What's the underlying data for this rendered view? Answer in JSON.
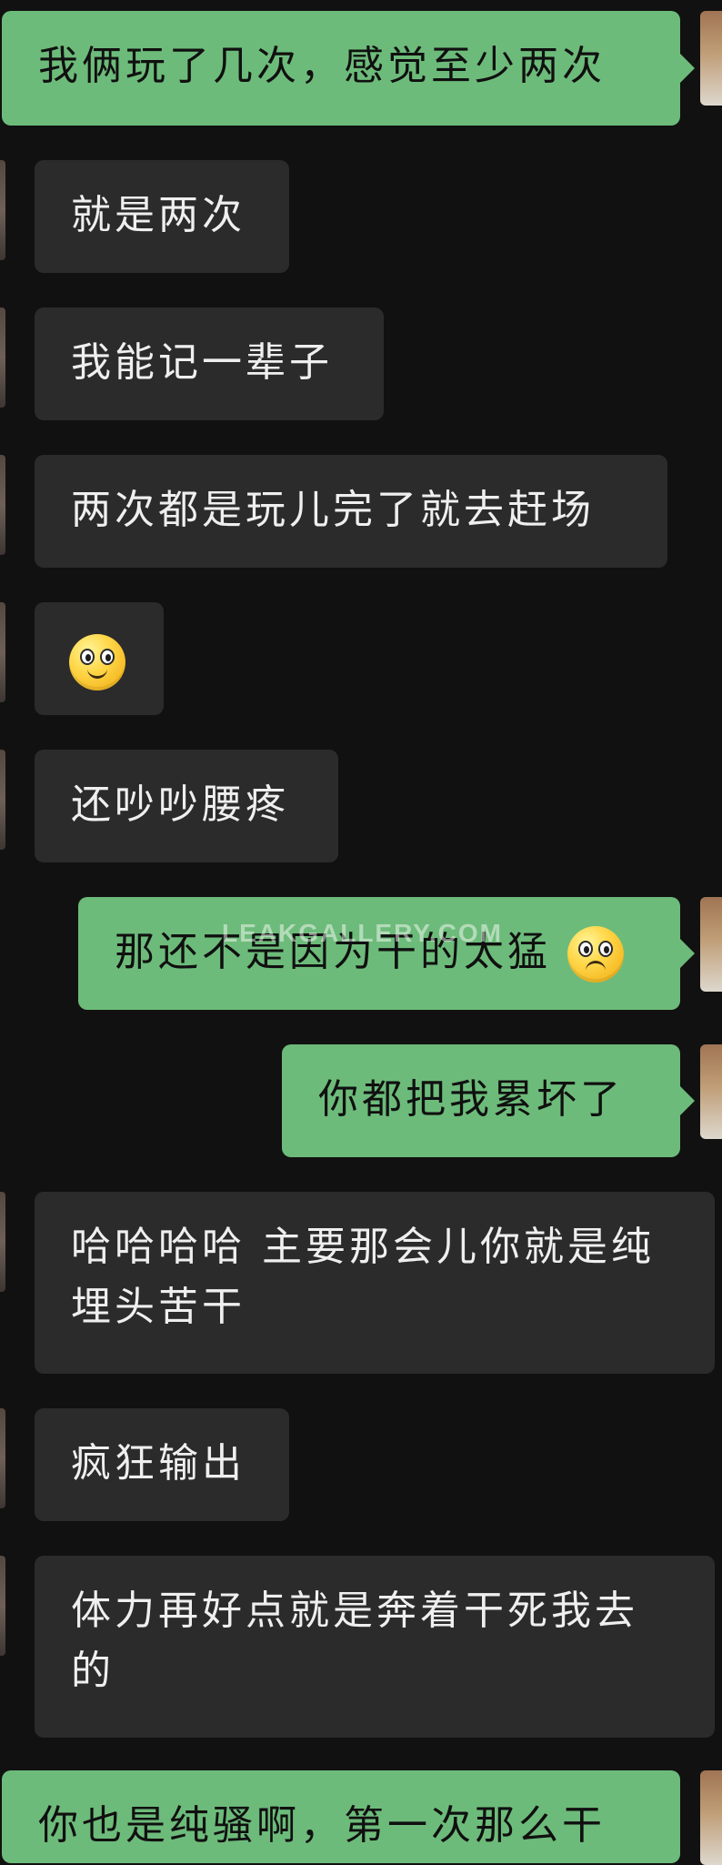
{
  "chat": {
    "messages": [
      {
        "id": "m1",
        "side": "right",
        "text": "我俩玩了几次，感觉至少两次"
      },
      {
        "id": "m2",
        "side": "left",
        "text": "就是两次"
      },
      {
        "id": "m3",
        "side": "left",
        "text": "我能记一辈子"
      },
      {
        "id": "m4",
        "side": "left",
        "text": "两次都是玩儿完了就去赶场"
      },
      {
        "id": "m5",
        "side": "left",
        "emoji": "smile"
      },
      {
        "id": "m6",
        "side": "left",
        "text": "还吵吵腰疼"
      },
      {
        "id": "m7",
        "side": "right",
        "text": "那还不是因为干的太猛",
        "emoji": "pleading"
      },
      {
        "id": "m8",
        "side": "right",
        "text": "你都把我累坏了"
      },
      {
        "id": "m9",
        "side": "left",
        "text": "哈哈哈哈 主要那会儿你就是纯埋头苦干"
      },
      {
        "id": "m10",
        "side": "left",
        "text": "疯狂输出"
      },
      {
        "id": "m11",
        "side": "left",
        "text": "体力再好点就是奔着干死我去的"
      },
      {
        "id": "m12",
        "side": "right",
        "text": "你也是纯骚啊，第一次那么干"
      }
    ]
  },
  "watermark": "LEAKGALLERY.COM",
  "colors": {
    "background": "#111111",
    "incoming_bubble": "#2b2b2b",
    "outgoing_bubble": "#6dbb7a"
  }
}
